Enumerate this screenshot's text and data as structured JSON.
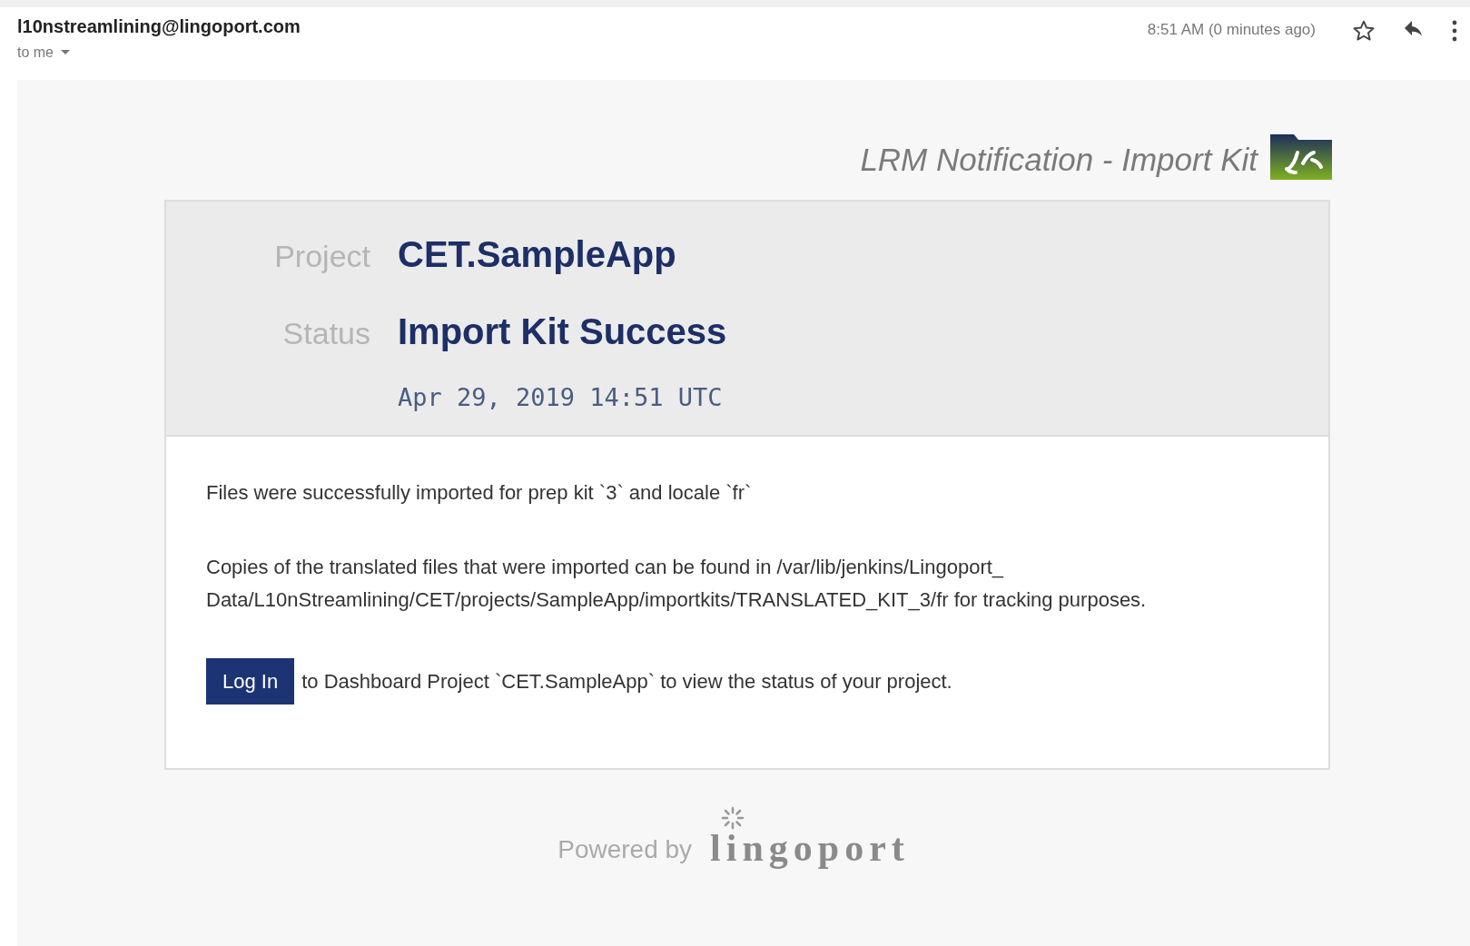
{
  "message": {
    "sender": "l10nstreamlining@lingoport.com",
    "recipient": "to me",
    "time": "8:51 AM (0 minutes ago)",
    "starred": false
  },
  "email": {
    "title": "LRM Notification - Import Kit",
    "summary": [
      {
        "label": "Project",
        "value": "CET.SampleApp"
      },
      {
        "label": "Status",
        "value": "Import Kit Success"
      }
    ],
    "date": "Apr 29, 2019 14:51 UTC",
    "paragraphs": [
      [
        "Files were successfully imported for prep kit `3` and locale `fr`"
      ],
      [
        "Copies of the translated files that were imported can be found in /var/lib/jenkins/Lingoport_",
        "Data/L10nStreamlining/CET/projects/SampleApp/importkits/TRANSLATED_KIT_3/fr for tracking purposes."
      ]
    ],
    "login": {
      "button": "Log In",
      "text": "to Dashboard Project `CET.SampleApp` to view the status of your project."
    },
    "footer": {
      "powered": "Powered by",
      "brand": "lingoport"
    }
  }
}
